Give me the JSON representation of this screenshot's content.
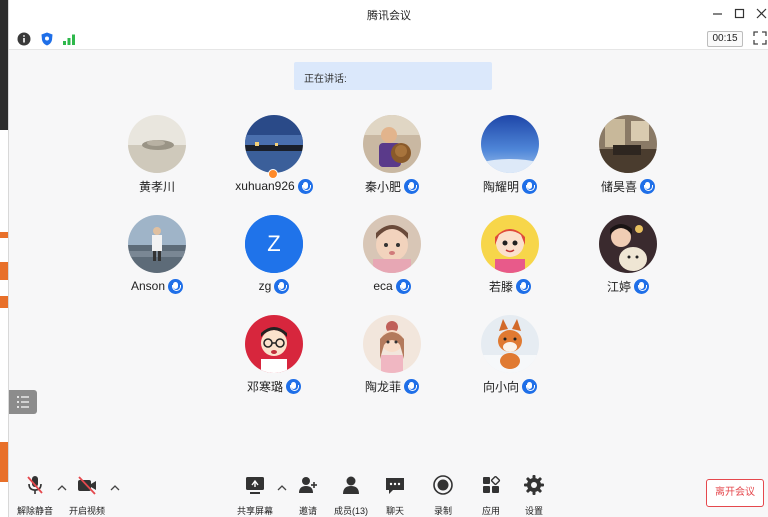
{
  "window": {
    "title": "腾讯会议"
  },
  "status": {
    "timer": "00:15"
  },
  "banner": {
    "speaking": "正在讲话:"
  },
  "participants": [
    {
      "name": "黄孝川",
      "mic": false,
      "avatar": "landscape-stone"
    },
    {
      "name": "xuhuan926",
      "mic": true,
      "host": true,
      "avatar": "night-lake"
    },
    {
      "name": "秦小肥",
      "mic": true,
      "avatar": "child-with-bear"
    },
    {
      "name": "陶耀明",
      "mic": true,
      "avatar": "blue-sky-earth"
    },
    {
      "name": "储昊喜",
      "mic": true,
      "avatar": "room-photo"
    },
    {
      "name": "Anson",
      "mic": true,
      "avatar": "person-beach"
    },
    {
      "name": "zg",
      "mic": true,
      "avatar": "letter-z",
      "initial": "Z"
    },
    {
      "name": "eca",
      "mic": true,
      "avatar": "baby"
    },
    {
      "name": "若滕",
      "mic": true,
      "avatar": "cartoon-girl"
    },
    {
      "name": "江婷",
      "mic": true,
      "avatar": "woman-dog"
    },
    {
      "name": "邓寒璐",
      "mic": true,
      "avatar": "cartoon-boy-glasses"
    },
    {
      "name": "陶龙菲",
      "mic": true,
      "avatar": "illustrated-girl"
    },
    {
      "name": "向小向",
      "mic": true,
      "avatar": "fox-snow"
    }
  ],
  "toolbar": {
    "unmute": "解除静音",
    "start_video": "开启视频",
    "share_screen": "共享屏幕",
    "invite": "邀请",
    "members": "成员(13)",
    "chat": "聊天",
    "record": "录制",
    "apps": "应用",
    "settings": "设置",
    "leave": "离开会议"
  },
  "colors": {
    "accent": "#1f6fe8",
    "leave": "#e5484d",
    "banner": "#dbe8fb"
  }
}
